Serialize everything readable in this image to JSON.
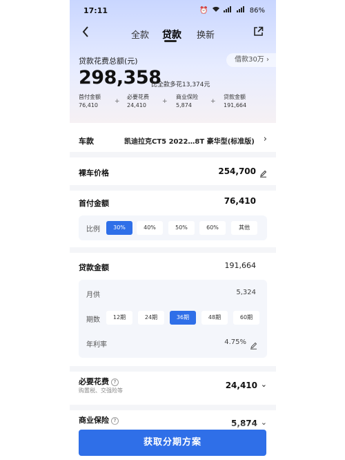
{
  "status_bar": {
    "time": "17:11",
    "battery": "86%"
  },
  "nav": {
    "tabs": [
      "全款",
      "贷款",
      "换新"
    ]
  },
  "summary": {
    "label": "贷款花费总额(元)",
    "loan_button": "借款30万",
    "total": "298,358",
    "compare": "比全款多花13,374元",
    "breakdown": [
      {
        "label": "首付金额",
        "value": "76,410"
      },
      {
        "label": "必要花费",
        "value": "24,410"
      },
      {
        "label": "商业保险",
        "value": "5,874"
      },
      {
        "label": "贷款金额",
        "value": "191,664"
      }
    ]
  },
  "model": {
    "label": "车款",
    "value": "凯迪拉克CT5 2022…8T 豪华型(标准版)"
  },
  "car_price": {
    "label": "裸车价格",
    "value": "254,700"
  },
  "down_payment": {
    "label": "首付金额",
    "value": "76,410",
    "ratio_label": "比例",
    "options": [
      "30%",
      "40%",
      "50%",
      "60%",
      "其他"
    ],
    "selected": "30%"
  },
  "loan": {
    "label": "贷款金额",
    "value": "191,664",
    "monthly_label": "月供",
    "monthly_value": "5,324",
    "term_label": "期数",
    "terms": [
      "12期",
      "24期",
      "36期",
      "48期",
      "60期"
    ],
    "selected_term": "36期",
    "rate_label": "年利率",
    "rate_value": "4.75%"
  },
  "required_costs": {
    "label": "必要花费",
    "sub": "购置税、交强险等",
    "value": "24,410"
  },
  "insurance": {
    "label": "商业保险",
    "value": "5,874"
  },
  "cta": {
    "label": "获取分期方案"
  },
  "colors": {
    "accent": "#2f6fe8"
  }
}
